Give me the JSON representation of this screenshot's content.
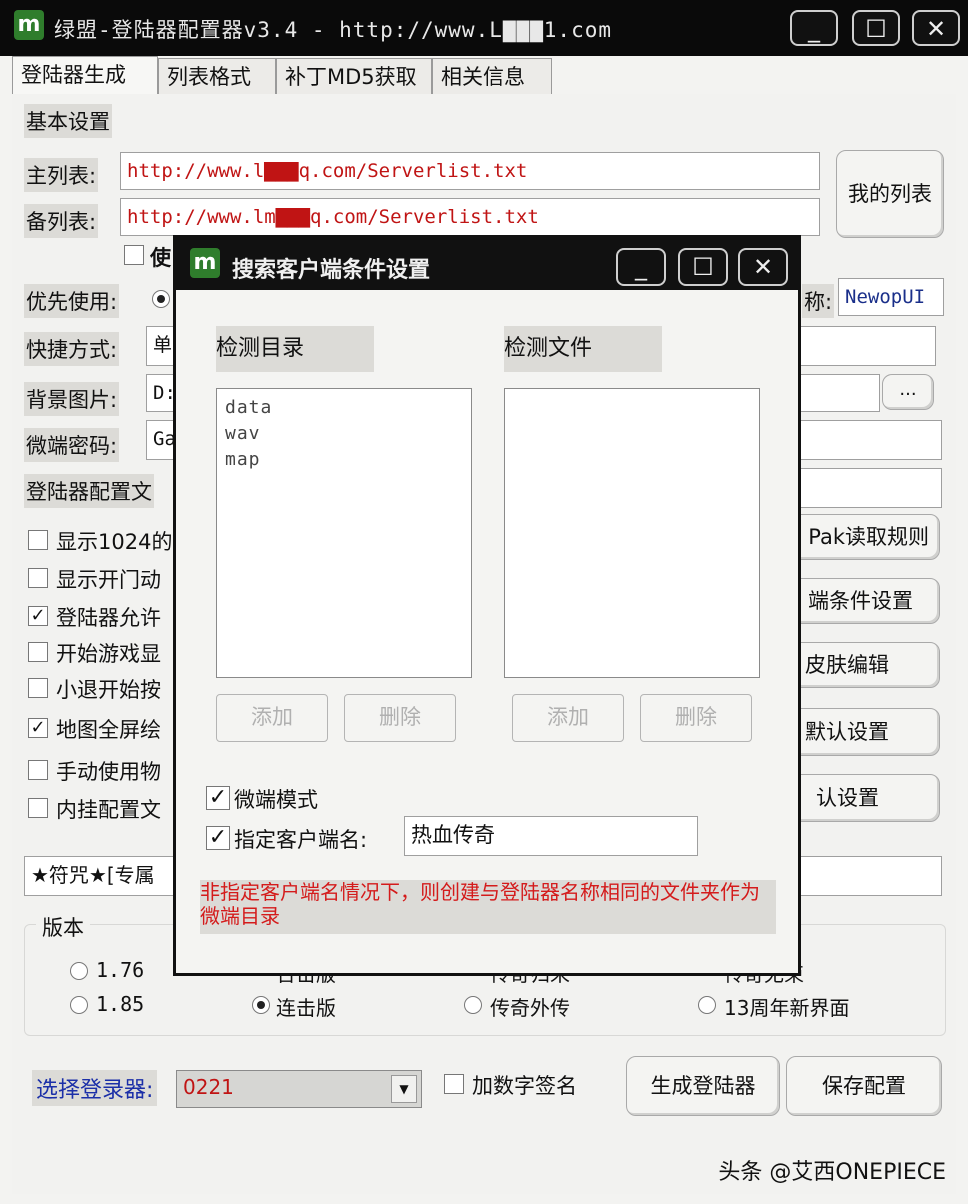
{
  "window": {
    "title": "绿盟-登陆器配置器v3.4 - http://www.L▇▇▇1.com",
    "minimize": "_",
    "maximize": "☐",
    "close": "✕"
  },
  "tabs": [
    "登陆器生成",
    "列表格式",
    "补丁MD5获取",
    "相关信息"
  ],
  "basic": {
    "section": "基本设置",
    "main_list_label": "主列表:",
    "main_list_value": "http://www.l▇▇▇q.com/Serverlist.txt",
    "backup_list_label": "备列表:",
    "backup_list_value": "http://www.lm▇▇▇q.com/Serverlist.txt",
    "my_list_button": "我的列表",
    "use_checkbox_label": "使",
    "priority_label": "优先使用:",
    "name_suffix_label": "称:",
    "name_value": "NewopUI",
    "shortcut_label": "快捷方式:",
    "shortcut_value": "单",
    "bg_label": "背景图片:",
    "bg_value": "D:",
    "browse_button": "...",
    "micro_pwd_label": "微端密码:",
    "micro_pwd_value": "Ga",
    "config_file_label": "登陆器配置文"
  },
  "checkboxes": [
    {
      "label": "显示1024的",
      "checked": false
    },
    {
      "label": "显示开门动",
      "checked": false
    },
    {
      "label": "登陆器允许",
      "checked": true
    },
    {
      "label": "开始游戏显",
      "checked": false
    },
    {
      "label": "小退开始按",
      "checked": false
    },
    {
      "label": "地图全屏绘",
      "checked": true
    },
    {
      "label": "手动使用物",
      "checked": false
    },
    {
      "label": "内挂配置文",
      "checked": false
    }
  ],
  "right_buttons": [
    "Pak读取规则",
    "端条件设置",
    "皮肤编辑",
    "默认设置",
    "认设置"
  ],
  "bottom_field": "★符咒★[专属",
  "version": {
    "title": "版本",
    "row1": [
      "1.76",
      "合击版",
      "传奇归来",
      "传奇无束"
    ],
    "row2": [
      "1.85",
      "连击版",
      "传奇外传",
      "13周年新界面"
    ]
  },
  "footer": {
    "select_label": "选择登录器:",
    "select_value": "0221",
    "sign_checkbox": "加数字签名",
    "generate_button": "生成登陆器",
    "save_button": "保存配置",
    "watermark": "头条 @艾西ONEPIECE"
  },
  "dialog": {
    "title": "搜索客户端条件设置",
    "dir_header": "检测目录",
    "file_header": "检测文件",
    "dir_items": [
      "data",
      "wav",
      "map"
    ],
    "file_items": [],
    "add_label": "添加",
    "delete_label": "删除",
    "micro_mode_label": "微端模式",
    "micro_mode_checked": true,
    "client_name_label": "指定客户端名:",
    "client_name_checked": true,
    "client_name_value": "热血传奇",
    "note": "非指定客户端名情况下，则创建与登陆器名称相同的文件夹作为微端目录"
  },
  "colors": {
    "accent_red": "#c01414",
    "title_bg": "#111111",
    "logo_green": "#2f7d2c"
  }
}
